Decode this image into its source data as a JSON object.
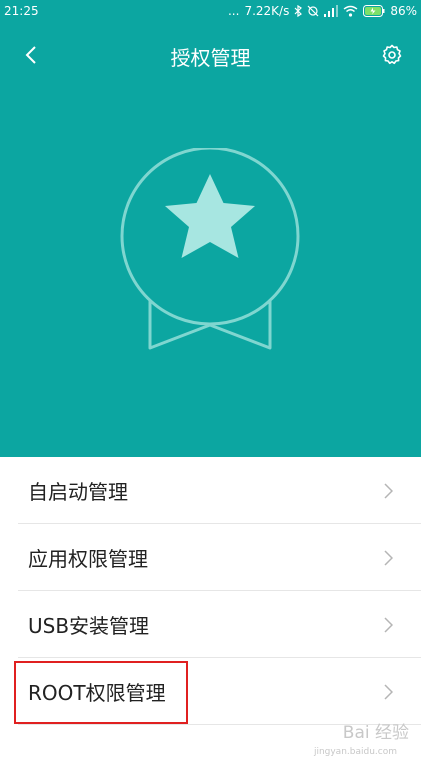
{
  "status_bar": {
    "time": "21:25",
    "dots": "...",
    "speed": "7.22K/s",
    "battery": "86%"
  },
  "header": {
    "title": "授权管理"
  },
  "menu": [
    {
      "label": "自启动管理"
    },
    {
      "label": "应用权限管理"
    },
    {
      "label": "USB安装管理"
    },
    {
      "label": "ROOT权限管理"
    }
  ],
  "watermark": {
    "brand": "Bai 经验",
    "domain": "jingyan.baidu.com"
  },
  "colors": {
    "primary": "#0ca6a1",
    "highlight": "#e02020"
  }
}
